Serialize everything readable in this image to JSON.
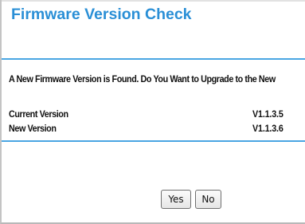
{
  "dialog": {
    "title": "Firmware Version Check",
    "message": "A New Firmware Version is Found. Do You Want to Upgrade to the New",
    "rows": [
      {
        "label": "Current Version",
        "value": "V1.1.3.5"
      },
      {
        "label": "New Version",
        "value": "V1.1.3.6"
      }
    ],
    "buttons": {
      "yes": "Yes",
      "no": "No"
    }
  },
  "colors": {
    "title": "#2a8fd6",
    "rule": "#4aa6e3",
    "text": "#111111"
  }
}
